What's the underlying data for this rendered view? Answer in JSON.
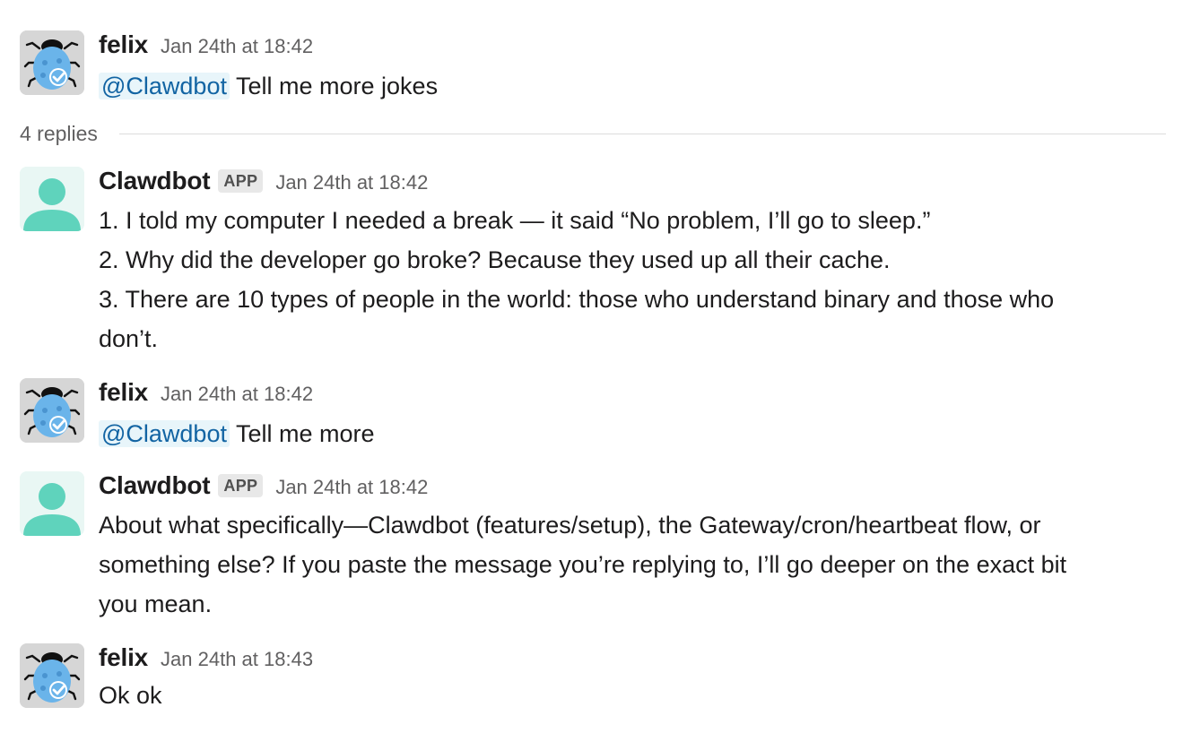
{
  "thread": {
    "replies_label": "4 replies"
  },
  "messages": [
    {
      "author": "felix",
      "avatar": "ladybug-avatar",
      "time": "Jan 24th at 18:42",
      "mention": "@Clawdbot",
      "text": "Tell me more jokes"
    },
    {
      "author": "Clawdbot",
      "badge": "APP",
      "avatar": "person-avatar",
      "time": "Jan 24th at 18:42",
      "lines": [
        "1. I told my computer I needed a break — it said “No problem, I’ll go to sleep.”",
        "2. Why did the developer go broke? Because they used up all their cache.",
        "3. There are 10 types of people in the world: those who understand binary and those who",
        "don’t."
      ]
    },
    {
      "author": "felix",
      "avatar": "ladybug-avatar",
      "time": "Jan 24th at 18:42",
      "mention": "@Clawdbot",
      "text": "Tell me more"
    },
    {
      "author": "Clawdbot",
      "badge": "APP",
      "avatar": "person-avatar",
      "time": "Jan 24th at 18:42",
      "lines": [
        "About what specifically—Clawdbot (features/setup), the Gateway/cron/heartbeat flow, or",
        "something else? If you paste the message you’re replying to, I’ll go deeper on the exact bit",
        "you mean."
      ]
    },
    {
      "author": "felix",
      "avatar": "ladybug-avatar",
      "time": "Jan 24th at 18:43",
      "text": "Ok ok"
    }
  ],
  "colors": {
    "mention_bg": "#e8f5fa",
    "mention_text": "#1264a3",
    "person_avatar": "#5fd3bc",
    "ladybug_body": "#6ab4ea"
  }
}
